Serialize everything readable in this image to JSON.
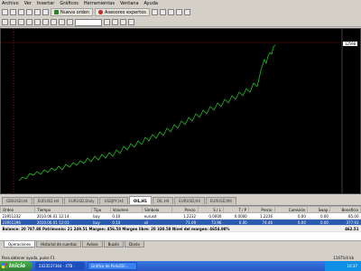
{
  "menu": [
    "Archivo",
    "Ver",
    "Insertar",
    "Gráficos",
    "Herramientas",
    "Ventana",
    "Ayuda"
  ],
  "toolbar": {
    "new_order": "Nueva orden",
    "expert_advisors": "Asesores expertos"
  },
  "chart": {
    "price_label": "12590"
  },
  "symbol_tabs": [
    "GBSUSD,H4",
    "EURUSD,H4",
    "EURUSD,Daily",
    "USDJPY,H4",
    "OIL,H1",
    "OIL,H4",
    "EURUSD,H4",
    "EURUSD,M4"
  ],
  "terminal": {
    "headers": [
      "Orden",
      "Tiempo",
      "Tipo",
      "Volumen",
      "Símbolo",
      "Precio",
      "S / L",
      "T / P",
      "Precio",
      "Comisión",
      "Swap",
      "Beneficio"
    ],
    "rows": [
      [
        "23951232",
        "2010.06.01 12:14",
        "buy",
        "0.10",
        "eurusd",
        "1.2232",
        "0.0000",
        "0.0000",
        "1.2236",
        "0.00",
        "0.00",
        "85.00"
      ],
      [
        "23951296",
        "2010.06.01 12:03",
        "buy",
        "0.10",
        "oil",
        "71.09",
        "73.96",
        "0.00",
        "74.46",
        "0.00",
        "0.00",
        "377.93"
      ]
    ],
    "balance": "Balance: 20 787.88  Patrimonio: 21 249.51  Margen: 456.58  Margen libre: 20 330.58  Nivel del margen: 4654.98%",
    "balance_total": "462.51"
  },
  "bottom_tabs": [
    "Operaciones",
    "Historial de cuentas",
    "Avisos",
    "Buzón",
    "Diario"
  ],
  "status": {
    "help": "Para obtener ayuda, pulse F1",
    "kb": "11675/4 kb"
  },
  "taskbar": {
    "start": "Inicio",
    "tasks": [
      "2323537364 - XTB -",
      "Gráfico de PoliciOil..."
    ],
    "clock": "10:37"
  }
}
